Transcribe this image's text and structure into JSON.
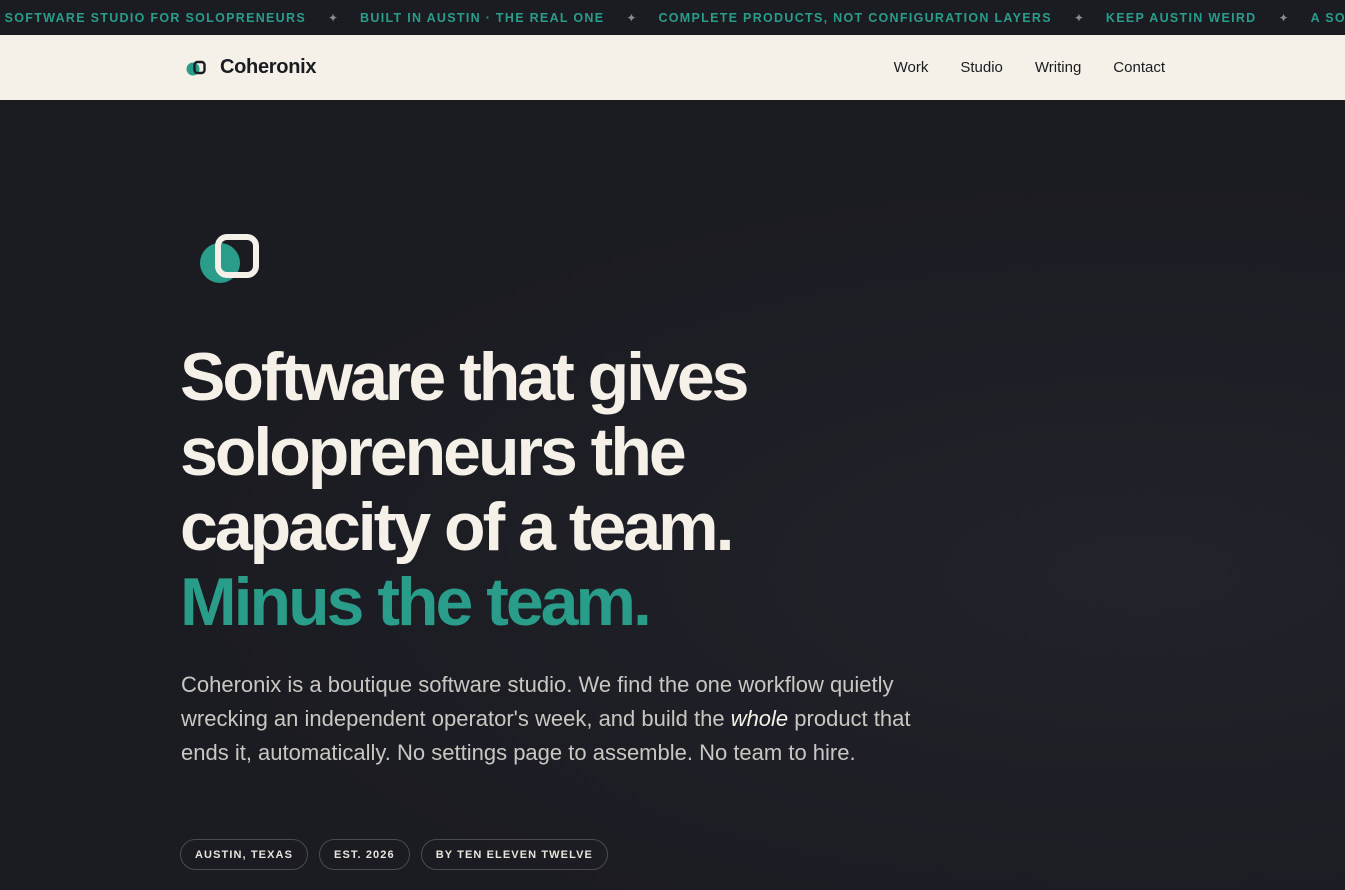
{
  "ticker": {
    "items": [
      "A SOFTWARE STUDIO FOR SOLOPRENEURS",
      "BUILT IN AUSTIN · THE REAL ONE",
      "COMPLETE PRODUCTS, NOT CONFIGURATION LAYERS",
      "KEEP AUSTIN WEIRD",
      "A SOFT"
    ],
    "separator": "✦"
  },
  "nav": {
    "brand": "Coheronix",
    "links": [
      "Work",
      "Studio",
      "Writing",
      "Contact"
    ]
  },
  "hero": {
    "headline": [
      "Software that gives",
      "solopreneurs the",
      "capacity of a team."
    ],
    "headline_accent": "Minus the team.",
    "intro_part1": "Coheronix is a boutique software studio. We find the one workflow quietly wrecking an independent operator's week, and build the ",
    "intro_emphasis": "whole",
    "intro_part2": " product that ends it, automatically. No settings page to assemble. No team to hire.",
    "tags": [
      "AUSTIN, TEXAS",
      "EST. 2026",
      "BY TEN ELEVEN TWELVE"
    ]
  },
  "colors": {
    "background": "#1b1b22",
    "cream": "#f5f1e8",
    "accent": "#2a9d8a"
  },
  "icons": {
    "logo": "overlapping-circle-square-logo-icon",
    "separator": "four-point-star-icon"
  }
}
